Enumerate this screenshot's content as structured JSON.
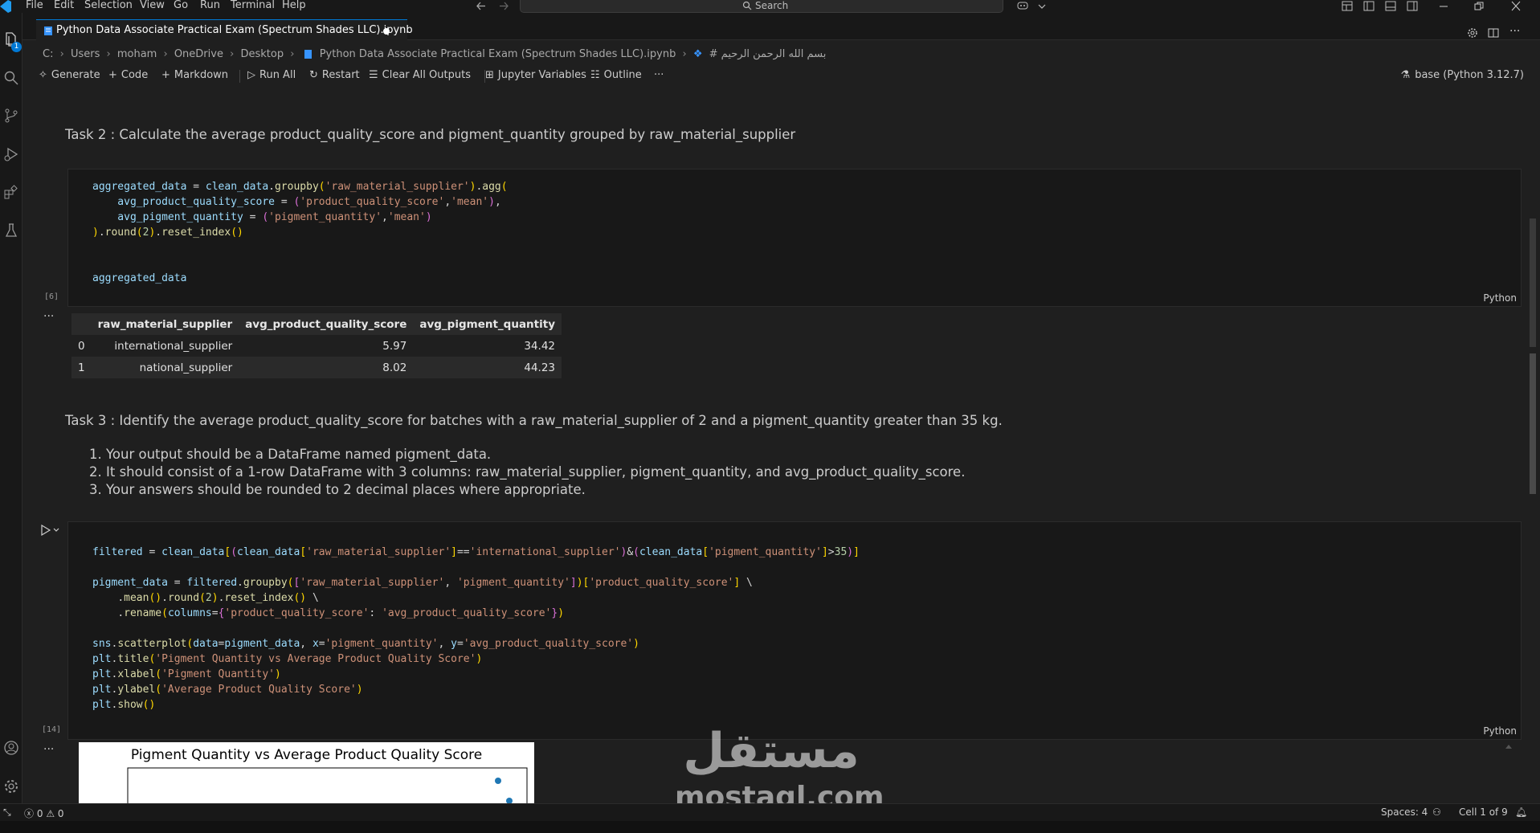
{
  "menu": [
    "File",
    "Edit",
    "Selection",
    "View",
    "Go",
    "Run",
    "Terminal",
    "Help"
  ],
  "search": {
    "label": "Search"
  },
  "tab": {
    "title": "Python Data Associate Practical Exam (Spectrum Shades LLC).ipynb"
  },
  "activity_badge": "1",
  "breadcrumb": {
    "parts": [
      "C:",
      "Users",
      "moham",
      "OneDrive",
      "Desktop",
      "Python Data Associate Practical Exam (Spectrum Shades LLC).ipynb"
    ],
    "heading": "# بسم الله الرحمن الرحيم"
  },
  "toolbar": {
    "generate": "Generate",
    "code": "Code",
    "markdown": "Markdown",
    "run_all": "Run All",
    "restart": "Restart",
    "clear_outputs": "Clear All Outputs",
    "variables": "Jupyter Variables",
    "outline": "Outline",
    "more": "···",
    "kernel": "base (Python 3.12.7)"
  },
  "task2": {
    "text": "Task 2 : Calculate the average product_quality_score and pigment_quantity grouped by raw_material_supplier"
  },
  "cell6": {
    "exec": "[6]",
    "lang": "Python"
  },
  "df": {
    "columns": [
      "",
      "raw_material_supplier",
      "avg_product_quality_score",
      "avg_pigment_quantity"
    ],
    "rows": [
      [
        "0",
        "international_supplier",
        "5.97",
        "34.42"
      ],
      [
        "1",
        "national_supplier",
        "8.02",
        "44.23"
      ]
    ]
  },
  "task3": {
    "text": "Task 3 : Identify the average product_quality_score for batches with a raw_material_supplier of 2 and a pigment_quantity greater than 35 kg.",
    "items": [
      "Your output should be a DataFrame named pigment_data.",
      "It should consist of a 1-row DataFrame with 3 columns: raw_material_supplier, pigment_quantity, and avg_product_quality_score.",
      "Your answers should be rounded to 2 decimal places where appropriate."
    ]
  },
  "cell14": {
    "exec": "[14]",
    "lang": "Python"
  },
  "chart_data": {
    "type": "scatter",
    "title": "Pigment Quantity vs Average Product Quality Score",
    "xlabel": "Pigment Quantity",
    "ylabel": "Average Product Quality Score"
  },
  "statusbar": {
    "errors": "0",
    "warnings": "0",
    "spaces": "Spaces: 4",
    "cell": "Cell 1 of 9"
  },
  "watermark": {
    "arabic": "مستقل",
    "latin": "mostaql.com"
  },
  "colors": {
    "accent": "#0078d4",
    "bg": "#1f1f1f",
    "cell_bg": "#181818"
  }
}
